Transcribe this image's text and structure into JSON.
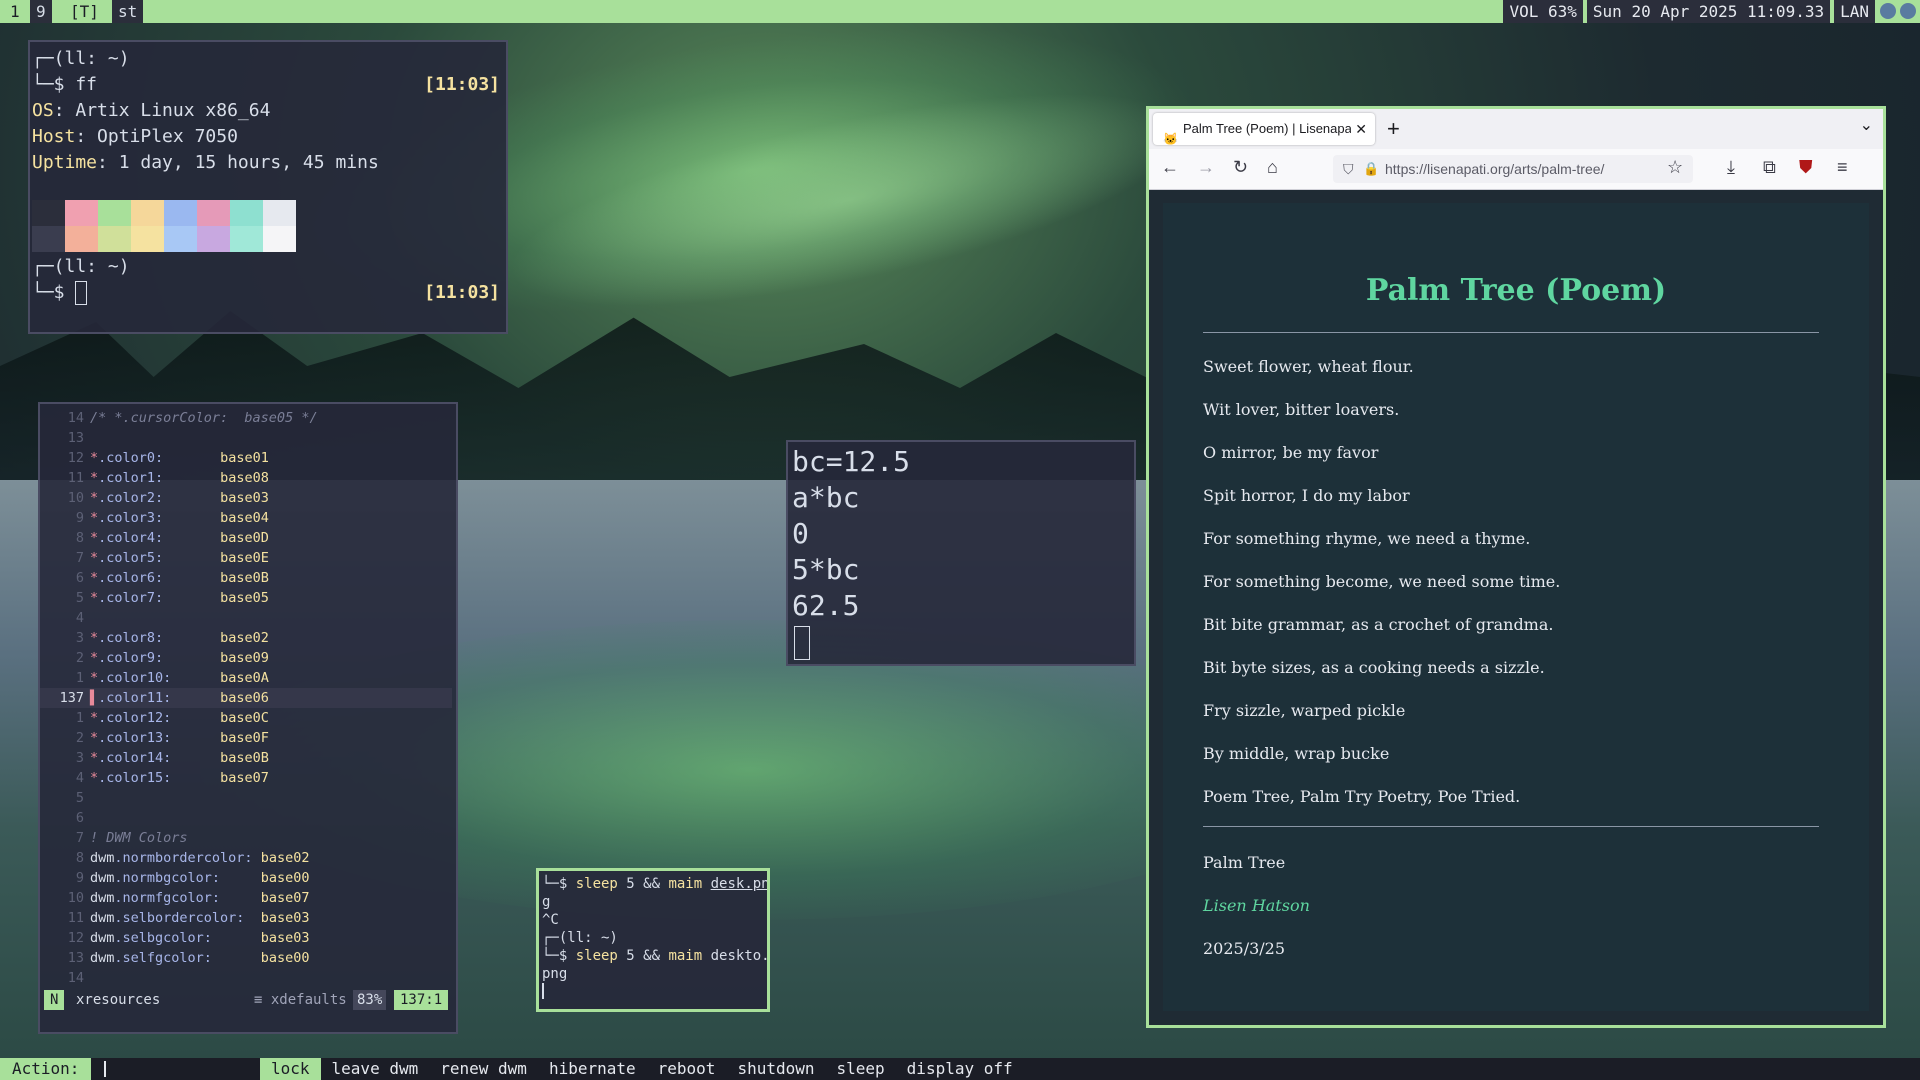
{
  "topbar": {
    "tags": [
      "1",
      "9",
      "[T]",
      "st"
    ],
    "status": [
      "VOL 63%",
      "Sun 20 Apr 2025 11:09.33",
      "LAN"
    ]
  },
  "fetch_terminal": {
    "prompt1": "┌─(ll: ~)",
    "cmd1": "└─$ ff",
    "time1": "[11:03]",
    "os_key": "OS",
    "os_val": ": Artix Linux x86_64",
    "host_key": "Host",
    "host_val": ": OptiPlex 7050",
    "uptime_key": "Uptime",
    "uptime_val": ": 1 day, 15 hours, 45 mins",
    "prompt2": "┌─(ll: ~)",
    "cmd2": "└─$ ",
    "time2": "[11:03]",
    "palette_top": [
      "#2b2e3b",
      "#f0a0b0",
      "#a8e09a",
      "#f5d79a",
      "#9ab8f0",
      "#e59ab8",
      "#8ee0d0",
      "#e6e9ef"
    ],
    "palette_bottom": [
      "#3a3d4f",
      "#f3b09a",
      "#d0e09a",
      "#f5e2a0",
      "#a8c8f5",
      "#c8a8e0",
      "#a0e8d8",
      "#f5f5f7"
    ]
  },
  "editor": {
    "lines": [
      {
        "ln": "14",
        "text": "/* *.cursorColor:  base05 */",
        "kind": "comment"
      },
      {
        "ln": "13",
        "text": "",
        "kind": "blank"
      },
      {
        "ln": "12",
        "prop": ".color0:",
        "val": "base01"
      },
      {
        "ln": "11",
        "prop": ".color1:",
        "val": "base08"
      },
      {
        "ln": "10",
        "prop": ".color2:",
        "val": "base03"
      },
      {
        "ln": "9",
        "prop": ".color3:",
        "val": "base04"
      },
      {
        "ln": "8",
        "prop": ".color4:",
        "val": "base0D"
      },
      {
        "ln": "7",
        "prop": ".color5:",
        "val": "base0E"
      },
      {
        "ln": "6",
        "prop": ".color6:",
        "val": "base0B"
      },
      {
        "ln": "5",
        "prop": ".color7:",
        "val": "base05"
      },
      {
        "ln": "4",
        "text": "",
        "kind": "blank"
      },
      {
        "ln": "3",
        "prop": ".color8:",
        "val": "base02"
      },
      {
        "ln": "2",
        "prop": ".color9:",
        "val": "base09"
      },
      {
        "ln": "1",
        "prop": ".color10:",
        "val": "base0A"
      },
      {
        "ln": "137",
        "prop": ".color11:",
        "val": "base06",
        "current": true
      },
      {
        "ln": "1",
        "prop": ".color12:",
        "val": "base0C"
      },
      {
        "ln": "2",
        "prop": ".color13:",
        "val": "base0F"
      },
      {
        "ln": "3",
        "prop": ".color14:",
        "val": "base0B"
      },
      {
        "ln": "4",
        "prop": ".color15:",
        "val": "base07"
      },
      {
        "ln": "5",
        "text": "",
        "kind": "blank"
      },
      {
        "ln": "6",
        "text": "",
        "kind": "blank"
      },
      {
        "ln": "7",
        "text": "! DWM Colors",
        "kind": "comment"
      },
      {
        "ln": "8",
        "dwm": "dwm",
        "prop": ".normbordercolor:",
        "val": "base02"
      },
      {
        "ln": "9",
        "dwm": "dwm",
        "prop": ".normbgcolor:    ",
        "val": "base00"
      },
      {
        "ln": "10",
        "dwm": "dwm",
        "prop": ".normfgcolor:    ",
        "val": "base07"
      },
      {
        "ln": "11",
        "dwm": "dwm",
        "prop": ".selbordercolor: ",
        "val": "base03"
      },
      {
        "ln": "12",
        "dwm": "dwm",
        "prop": ".selbgcolor:     ",
        "val": "base03"
      },
      {
        "ln": "13",
        "dwm": "dwm",
        "prop": ".selfgcolor:     ",
        "val": "base00"
      },
      {
        "ln": "14",
        "text": "",
        "kind": "blank"
      }
    ],
    "statusline": {
      "mode": "N",
      "file": "xresources",
      "filetype": "≡ xdefaults",
      "percent": "83%",
      "position": "137:1"
    }
  },
  "calc": {
    "lines": [
      "bc=12.5",
      "a*bc",
      "0",
      "5*bc",
      "62.5"
    ]
  },
  "small_terminal": {
    "l1a": "└─$ ",
    "l1b": "sleep",
    "l1c": " 5 && ",
    "l1d": "maim",
    "l1e": " ",
    "l1f": "desk.pn",
    "l2": "g",
    "l3": "^C",
    "l4": "┌─(ll: ~)",
    "l5a": "└─$ ",
    "l5b": "sleep",
    "l5c": " 5 && ",
    "l5d": "maim",
    "l5e": " deskto.",
    "l6": "png"
  },
  "browser": {
    "tab_title": "Palm Tree (Poem) | Lisenapati",
    "url": "https://lisenapati.org/arts/palm-tree/",
    "page": {
      "title": "Palm Tree (Poem)",
      "poem": [
        "Sweet flower, wheat flour.",
        "Wit lover, bitter loavers.",
        "O mirror, be my favor",
        "Spit horror, I do my labor",
        "For something rhyme, we need a thyme.",
        "For something become, we need some time.",
        "Bit bite grammar, as a crochet of grandma.",
        "Bit byte sizes, as a cooking needs a sizzle.",
        "Fry sizzle, warped pickle",
        "By middle, wrap bucke",
        "Poem Tree, Palm Try Poetry, Poe Tried."
      ],
      "work": "Palm Tree",
      "author": "Lisen Hatson",
      "date": "2025/3/25"
    }
  },
  "bottombar": {
    "label": "Action:",
    "items": [
      "lock",
      "leave dwm",
      "renew dwm",
      "hibernate",
      "reboot",
      "shutdown",
      "sleep",
      "display off"
    ],
    "selected": "lock"
  }
}
